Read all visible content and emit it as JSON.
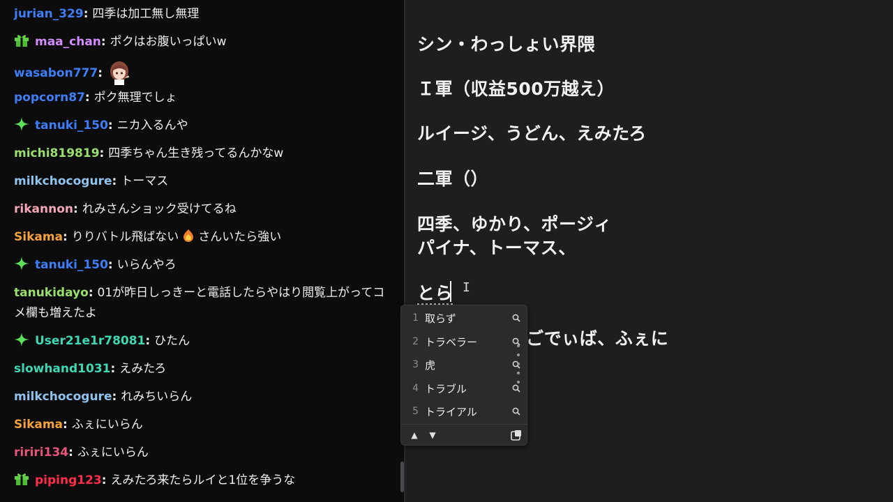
{
  "chat": {
    "messages": [
      {
        "user": "jurian_329",
        "color": "#3d7ef6",
        "badge": null,
        "text": "四季は加工無し無理"
      },
      {
        "user": "maa_chan",
        "color": "#d38cff",
        "badge": "gift-badge",
        "text": "ポクはお腹いっぱいw"
      },
      {
        "user": "wasabon777",
        "color": "#3d7ef6",
        "badge": null,
        "text": "",
        "emote": "anime-girl-emote"
      },
      {
        "user": "popcorn87",
        "color": "#3d7ef6",
        "badge": null,
        "text": "ポク無理でしょ"
      },
      {
        "user": "tanuki_150",
        "color": "#3d7ef6",
        "badge": "sparkle-badge",
        "text": "ニカ入るんや"
      },
      {
        "user": "michi819819",
        "color": "#9adf6b",
        "badge": null,
        "text": "四季ちゃん生き残ってるんかなw"
      },
      {
        "user": "milkchocogure",
        "color": "#8fc3ee",
        "badge": null,
        "text": "トーマス"
      },
      {
        "user": "rikannon",
        "color": "#f4a6b6",
        "badge": null,
        "text": "れみさんショック受けてるね"
      },
      {
        "user": "Sikama",
        "color": "#f5a23d",
        "badge": null,
        "text_before": "りりバトル飛ばない",
        "emote": "fire-heart-emote",
        "text": "さんいたら強い"
      },
      {
        "user": "tanuki_150",
        "color": "#3d7ef6",
        "badge": "sparkle-badge",
        "text": "いらんやろ"
      },
      {
        "user": "tanukidayo",
        "color": "#9adf6b",
        "badge": null,
        "text": "01が昨日しっきーと電話したらやはり閲覧上がってコメ欄も増えたよ"
      },
      {
        "user": "User21e1r78081",
        "color": "#3fd8b5",
        "badge": "sparkle-badge",
        "text": "ひたん"
      },
      {
        "user": "slowhand1031",
        "color": "#3fd8b5",
        "badge": null,
        "text": "えみたろ"
      },
      {
        "user": "milkchocogure",
        "color": "#8fc3ee",
        "badge": null,
        "text": "れみちいらん"
      },
      {
        "user": "Sikama",
        "color": "#f5a23d",
        "badge": null,
        "text": "ふぇにいらん"
      },
      {
        "user": "ririri134",
        "color": "#e8547a",
        "badge": null,
        "text": "ふぇにいらん"
      },
      {
        "user": "piping123",
        "color": "#ff2d4a",
        "badge": "gift-badge",
        "text": "えみたろ来たらルイと1位を争うな"
      }
    ]
  },
  "memo": {
    "lines": [
      "シン・わっしょい界隈",
      "Ｉ軍（収益500万越え）",
      "ルイージ、うどん、えみたろ",
      "二軍（）",
      "四季、ゆかり、ポージィ",
      "パイナ、トーマス、",
      "とら",
      "ごでぃば、ふぇに"
    ],
    "ibeam": "I"
  },
  "ime": {
    "candidates": [
      {
        "num": "1",
        "text": "取らず"
      },
      {
        "num": "2",
        "text": "トラベラー"
      },
      {
        "num": "3",
        "text": "虎"
      },
      {
        "num": "4",
        "text": "トラブル"
      },
      {
        "num": "5",
        "text": "トライアル"
      }
    ],
    "up_arrow": "▲",
    "down_arrow": "▼"
  },
  "colors": {
    "chat_bg": "#0c0c0d",
    "memo_bg": "#1e1e20",
    "ime_bg": "#2b2b2d"
  }
}
